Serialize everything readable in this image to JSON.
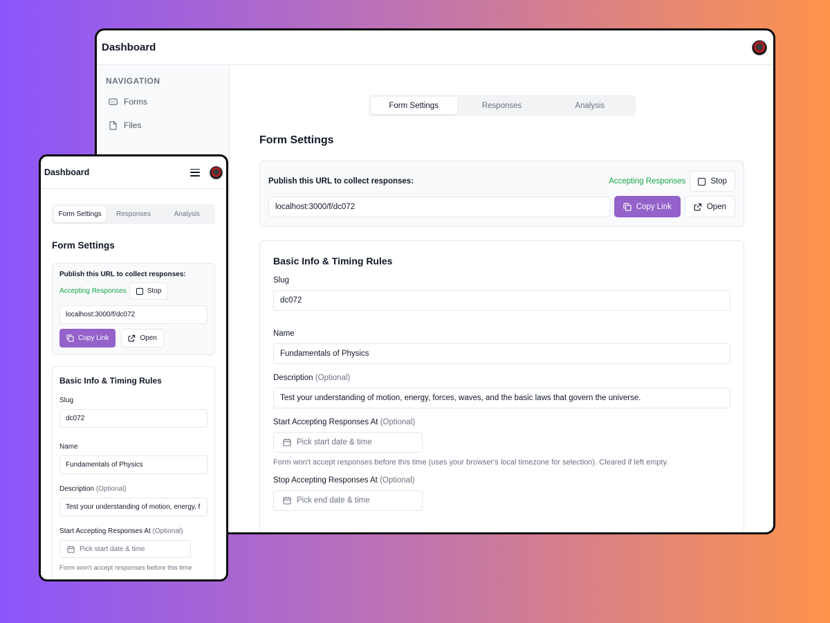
{
  "app": {
    "title": "Dashboard"
  },
  "sidebar": {
    "heading": "NAVIGATION",
    "items": [
      {
        "label": "Forms",
        "icon": "form-icon"
      },
      {
        "label": "Files",
        "icon": "file-icon"
      }
    ]
  },
  "tabs": [
    {
      "label": "Form Settings",
      "active": true
    },
    {
      "label": "Responses",
      "active": false
    },
    {
      "label": "Analysis",
      "active": false
    }
  ],
  "page_title": "Form Settings",
  "publish": {
    "label": "Publish this URL to collect responses:",
    "status": "Accepting Responses",
    "stop_label": "Stop",
    "url": "localhost:3000/f/dc072",
    "copy_label": "Copy Link",
    "open_label": "Open"
  },
  "basic": {
    "title": "Basic Info & Timing Rules",
    "slug": {
      "label": "Slug",
      "value": "dc072"
    },
    "name": {
      "label": "Name",
      "value": "Fundamentals of Physics"
    },
    "description": {
      "label": "Description",
      "optional": "(Optional)",
      "value": "Test your understanding of motion, energy, forces, waves, and the basic laws that govern the universe."
    },
    "start": {
      "label": "Start Accepting Responses At",
      "optional": "(Optional)",
      "placeholder": "Pick start date & time",
      "hint": "Form won't accept responses before this time (uses your browser's local timezone for selection). Cleared if left empty."
    },
    "stop": {
      "label": "Stop Accepting Responses At",
      "optional": "(Optional)",
      "placeholder": "Pick end date & time"
    }
  },
  "mobile": {
    "description_value": "Test your understanding of motion, energy, f",
    "start_hint": "Form won't accept responses before this time"
  },
  "colors": {
    "accent": "#9462ca",
    "success": "#16a34a",
    "background_start": "#8b55fb",
    "background_end": "#fd934c"
  }
}
